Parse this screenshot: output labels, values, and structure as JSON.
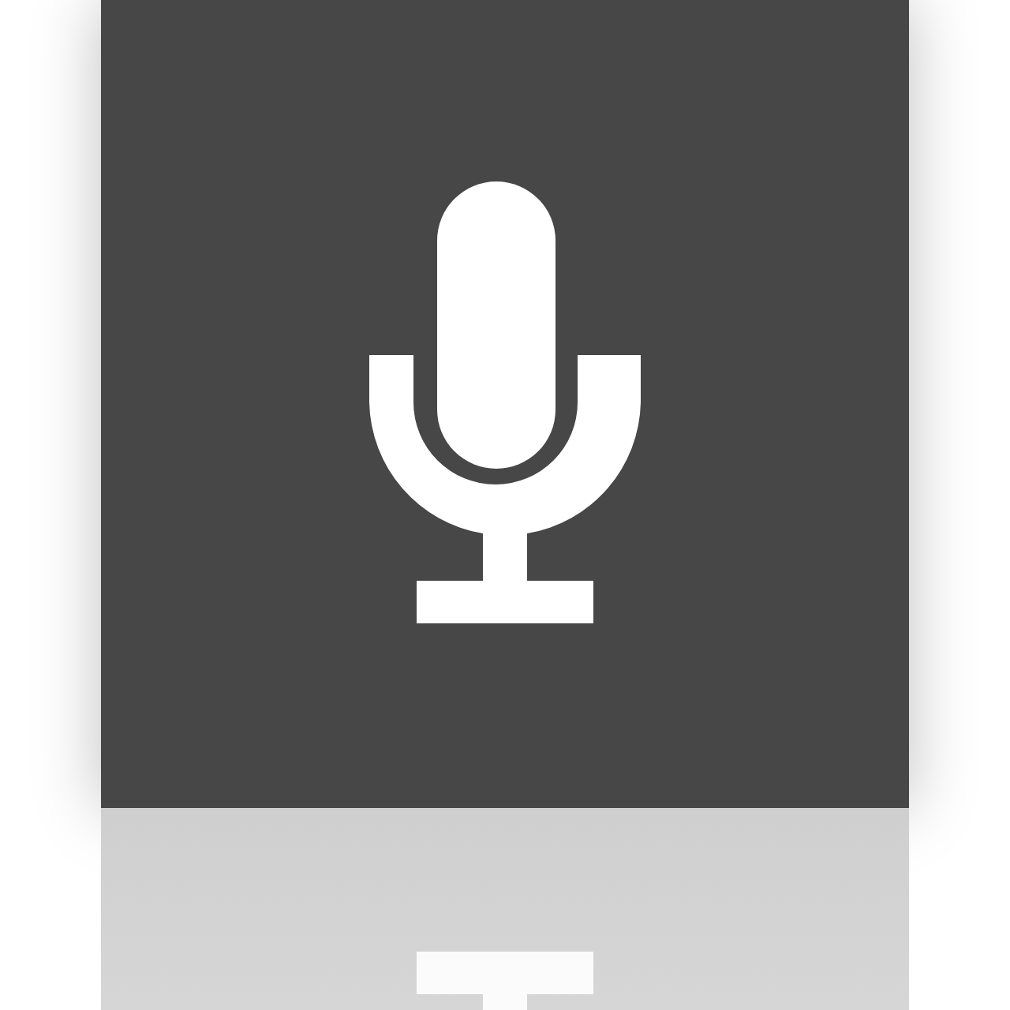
{
  "tile": {
    "kind": "microphone"
  }
}
